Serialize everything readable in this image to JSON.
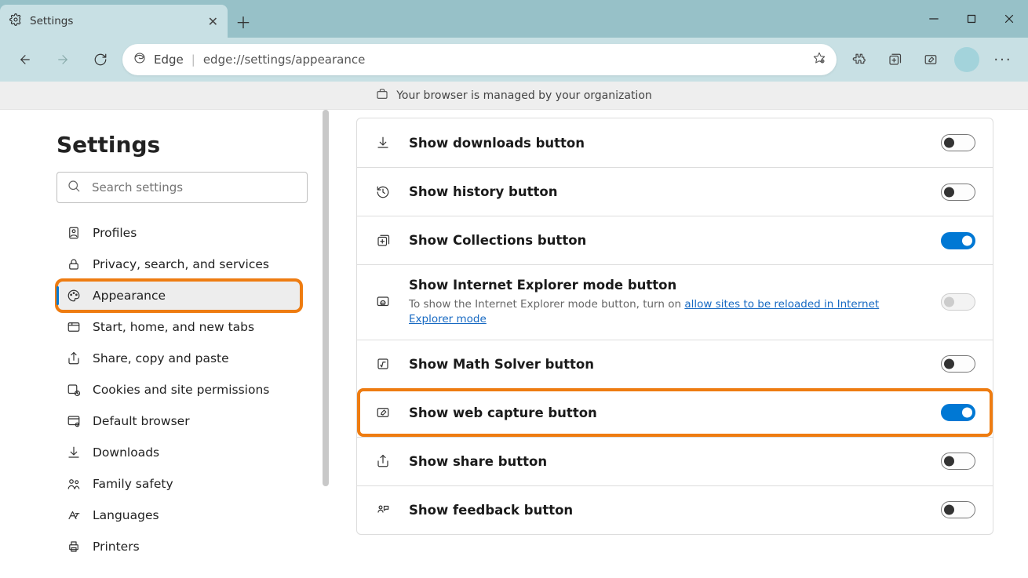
{
  "window": {
    "tab_title": "Settings",
    "minimize": "—",
    "maximize": "▢",
    "close": "✕"
  },
  "toolbar": {
    "edge_label": "Edge",
    "url": "edge://settings/appearance"
  },
  "banner": {
    "text": "Your browser is managed by your organization"
  },
  "sidebar": {
    "heading": "Settings",
    "search_placeholder": "Search settings",
    "items": [
      {
        "label": "Profiles"
      },
      {
        "label": "Privacy, search, and services"
      },
      {
        "label": "Appearance"
      },
      {
        "label": "Start, home, and new tabs"
      },
      {
        "label": "Share, copy and paste"
      },
      {
        "label": "Cookies and site permissions"
      },
      {
        "label": "Default browser"
      },
      {
        "label": "Downloads"
      },
      {
        "label": "Family safety"
      },
      {
        "label": "Languages"
      },
      {
        "label": "Printers"
      }
    ]
  },
  "rows": [
    {
      "title": "Show downloads button",
      "state": "off"
    },
    {
      "title": "Show history button",
      "state": "off"
    },
    {
      "title": "Show Collections button",
      "state": "on"
    },
    {
      "title": "Show Internet Explorer mode button",
      "state": "disabled",
      "desc_pre": "To show the Internet Explorer mode button, turn on ",
      "desc_link": "allow sites to be reloaded in Internet Explorer mode"
    },
    {
      "title": "Show Math Solver button",
      "state": "off"
    },
    {
      "title": "Show web capture button",
      "state": "on"
    },
    {
      "title": "Show share button",
      "state": "off"
    },
    {
      "title": "Show feedback button",
      "state": "off"
    }
  ]
}
